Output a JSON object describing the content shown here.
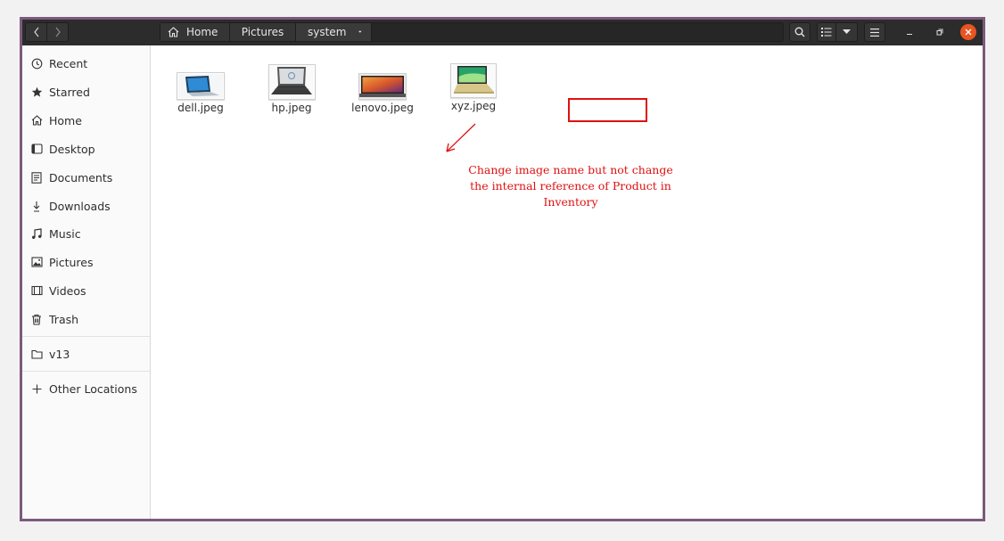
{
  "header": {
    "breadcrumb": [
      {
        "label": "Home",
        "icon": "home-icon"
      },
      {
        "label": "Pictures"
      },
      {
        "label": "system"
      }
    ]
  },
  "sidebar": {
    "places": [
      {
        "label": "Recent",
        "icon": "clock-icon"
      },
      {
        "label": "Starred",
        "icon": "star-icon"
      },
      {
        "label": "Home",
        "icon": "home-icon"
      },
      {
        "label": "Desktop",
        "icon": "desktop-icon"
      },
      {
        "label": "Documents",
        "icon": "document-icon"
      },
      {
        "label": "Downloads",
        "icon": "download-icon"
      },
      {
        "label": "Music",
        "icon": "music-icon"
      },
      {
        "label": "Pictures",
        "icon": "picture-icon"
      },
      {
        "label": "Videos",
        "icon": "video-icon"
      },
      {
        "label": "Trash",
        "icon": "trash-icon"
      }
    ],
    "devices": [
      {
        "label": "v13",
        "icon": "folder-icon"
      }
    ],
    "other": {
      "label": "Other Locations",
      "icon": "plus-icon"
    }
  },
  "files": [
    {
      "name": "dell.jpeg",
      "thumb_color": "#1f6fb5"
    },
    {
      "name": "hp.jpeg",
      "thumb_color": "#2a2a2a"
    },
    {
      "name": "lenovo.jpeg",
      "thumb_color": "#d8582a"
    },
    {
      "name": "xyz.jpeg",
      "thumb_color": "#27a36a"
    }
  ],
  "annotation": {
    "text": "Change image name but not change the internal reference of Product in Inventory",
    "color": "#e01010"
  },
  "colors": {
    "headerbar": "#2c2c2c",
    "window_border": "#7d5a7d",
    "close_button": "#e95420"
  }
}
